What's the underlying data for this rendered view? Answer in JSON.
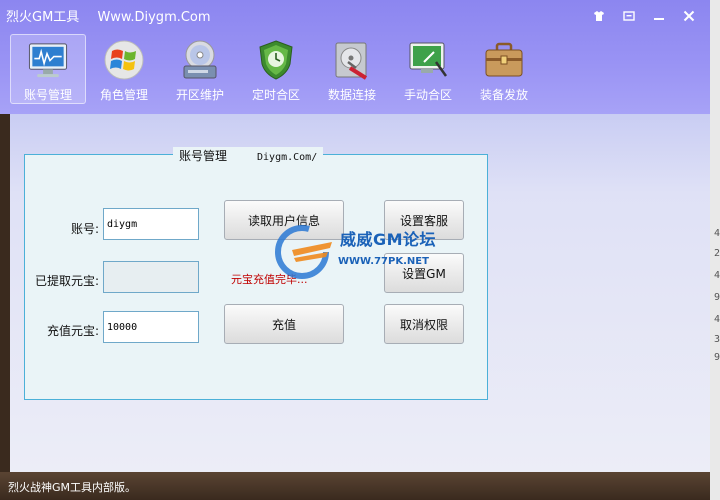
{
  "window": {
    "title": "烈火GM工具",
    "site": "Www.Diygm.Com",
    "buttons": [
      "skin-icon",
      "restore-icon",
      "minimize-icon",
      "close-icon"
    ]
  },
  "toolbar": {
    "items": [
      {
        "label": "账号管理",
        "icon": "monitor-icon",
        "active": true
      },
      {
        "label": "角色管理",
        "icon": "windows-logo-icon",
        "active": false
      },
      {
        "label": "开区维护",
        "icon": "disc-drive-icon",
        "active": false
      },
      {
        "label": "定时合区",
        "icon": "shield-clock-icon",
        "active": false
      },
      {
        "label": "数据连接",
        "icon": "disk-tools-icon",
        "active": false
      },
      {
        "label": "手动合区",
        "icon": "screen-pen-icon",
        "active": false
      },
      {
        "label": "装备发放",
        "icon": "toolbox-icon",
        "active": false
      }
    ]
  },
  "panel": {
    "title": "账号管理",
    "domain": "Diygm.Com/",
    "fields": {
      "account_label": "账号:",
      "account_value": "diygm",
      "extracted_label": "已提取元宝:",
      "extracted_value": "",
      "recharge_label": "充值元宝:",
      "recharge_value": "10000"
    },
    "buttons": {
      "read_user": "读取用户信息",
      "recharge": "充值",
      "set_cs": "设置客服",
      "set_gm": "设置GM",
      "cancel_perm": "取消权限"
    },
    "status_message": "元宝充值完毕..."
  },
  "watermark": {
    "line1": "威威GM论坛",
    "line2": "WWW.77PK.NET"
  },
  "statusbar": {
    "text": "烈火战神GM工具内部版。"
  },
  "background": {
    "side_numbers": [
      "4",
      "2",
      "4",
      "9",
      "4",
      "3",
      "9"
    ]
  },
  "colors": {
    "header": "#8c86f0",
    "panel_border": "#4bb0d8",
    "status_text": "#c00000"
  }
}
